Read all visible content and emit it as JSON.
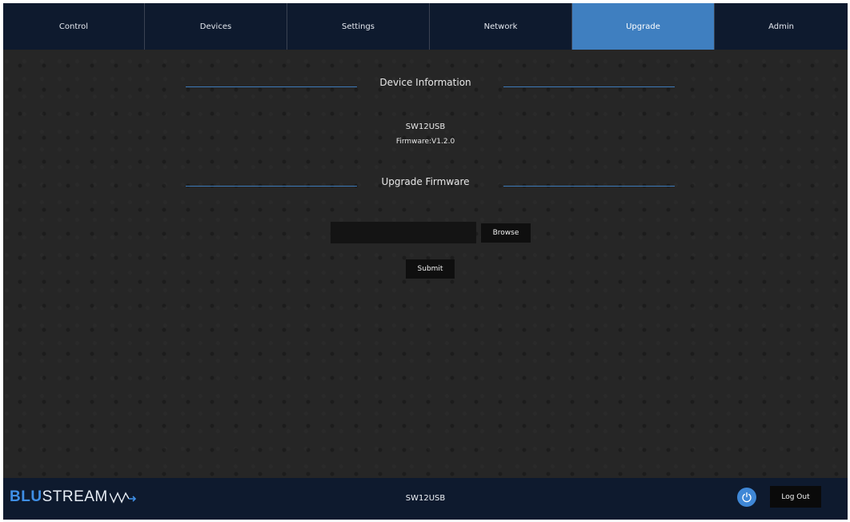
{
  "nav": {
    "tabs": [
      {
        "label": "Control",
        "active": false
      },
      {
        "label": "Devices",
        "active": false
      },
      {
        "label": "Settings",
        "active": false
      },
      {
        "label": "Network",
        "active": false
      },
      {
        "label": "Upgrade",
        "active": true
      },
      {
        "label": "Admin",
        "active": false
      }
    ]
  },
  "device_info": {
    "title": "Device Information",
    "model": "SW12USB",
    "firmware": "Firmware:V1.2.0"
  },
  "upgrade": {
    "title": "Upgrade Firmware",
    "file_value": "",
    "browse_label": "Browse",
    "submit_label": "Submit"
  },
  "footer": {
    "logo_blu": "BLU",
    "logo_stream": "STREAM",
    "device_name": "SW12USB",
    "logout_label": "Log Out"
  },
  "colors": {
    "nav_bg": "#0e1a2e",
    "active_tab": "#3f7fc0",
    "accent_rule": "#3c79b8",
    "brand_blue": "#3f8fe6",
    "content_bg": "#262626"
  }
}
